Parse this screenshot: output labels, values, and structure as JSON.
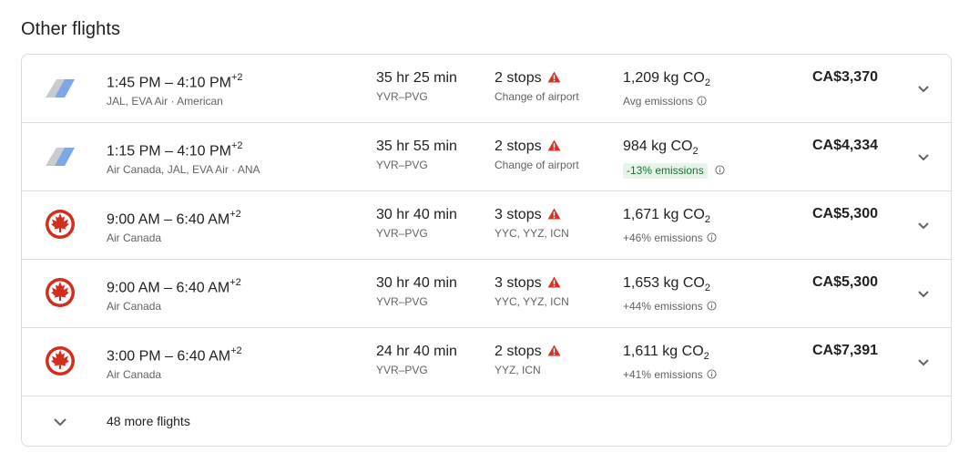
{
  "section_title": "Other flights",
  "colors": {
    "warning": "#d93025",
    "emissions_badge_bg": "#e6f4ea",
    "emissions_badge_text": "#137333",
    "air_canada_red": "#d22e1e"
  },
  "flights": [
    {
      "logo": "multi-airline-logo",
      "depart": "1:45 PM",
      "arrive": "4:10 PM",
      "day_offset": "+2",
      "airlines": "JAL, EVA Air · American",
      "duration": "35 hr 25 min",
      "route": "YVR–PVG",
      "stops": "2 stops",
      "stops_detail": "Change of airport",
      "co2": "1,209 kg CO",
      "co2_sub": "2",
      "emissions": "Avg emissions",
      "emissions_badge": false,
      "price": "CA$3,370"
    },
    {
      "logo": "multi-airline-logo",
      "depart": "1:15 PM",
      "arrive": "4:10 PM",
      "day_offset": "+2",
      "airlines": "Air Canada, JAL, EVA Air · ANA",
      "duration": "35 hr 55 min",
      "route": "YVR–PVG",
      "stops": "2 stops",
      "stops_detail": "Change of airport",
      "co2": "984 kg CO",
      "co2_sub": "2",
      "emissions": "-13% emissions",
      "emissions_badge": true,
      "price": "CA$4,334"
    },
    {
      "logo": "air-canada-logo",
      "depart": "9:00 AM",
      "arrive": "6:40 AM",
      "day_offset": "+2",
      "airlines": "Air Canada",
      "duration": "30 hr 40 min",
      "route": "YVR–PVG",
      "stops": "3 stops",
      "stops_detail": "YYC, YYZ, ICN",
      "co2": "1,671 kg CO",
      "co2_sub": "2",
      "emissions": "+46% emissions",
      "emissions_badge": false,
      "price": "CA$5,300"
    },
    {
      "logo": "air-canada-logo",
      "depart": "9:00 AM",
      "arrive": "6:40 AM",
      "day_offset": "+2",
      "airlines": "Air Canada",
      "duration": "30 hr 40 min",
      "route": "YVR–PVG",
      "stops": "3 stops",
      "stops_detail": "YYC, YYZ, ICN",
      "co2": "1,653 kg CO",
      "co2_sub": "2",
      "emissions": "+44% emissions",
      "emissions_badge": false,
      "price": "CA$5,300"
    },
    {
      "logo": "air-canada-logo",
      "depart": "3:00 PM",
      "arrive": "6:40 AM",
      "day_offset": "+2",
      "airlines": "Air Canada",
      "duration": "24 hr 40 min",
      "route": "YVR–PVG",
      "stops": "2 stops",
      "stops_detail": "YYZ, ICN",
      "co2": "1,611 kg CO",
      "co2_sub": "2",
      "emissions": "+41% emissions",
      "emissions_badge": false,
      "price": "CA$7,391"
    }
  ],
  "more_flights_label": "48 more flights"
}
